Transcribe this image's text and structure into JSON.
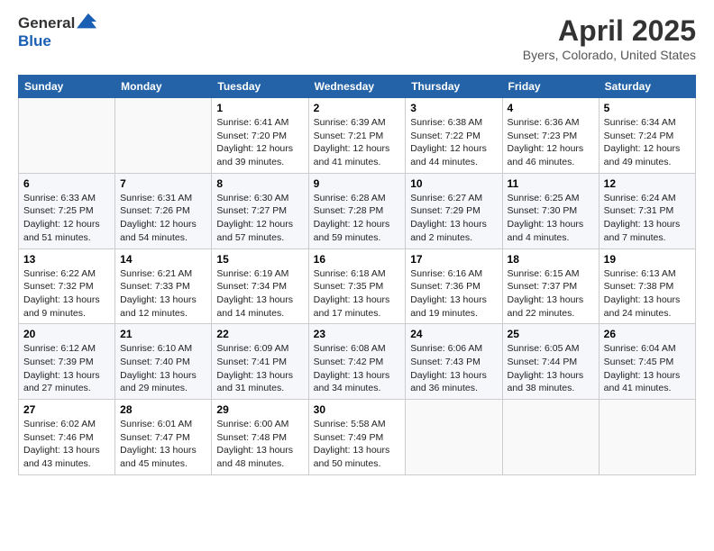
{
  "header": {
    "logo_line1": "General",
    "logo_line2": "Blue",
    "title": "April 2025",
    "subtitle": "Byers, Colorado, United States"
  },
  "weekdays": [
    "Sunday",
    "Monday",
    "Tuesday",
    "Wednesday",
    "Thursday",
    "Friday",
    "Saturday"
  ],
  "weeks": [
    [
      {
        "day": "",
        "info": ""
      },
      {
        "day": "",
        "info": ""
      },
      {
        "day": "1",
        "info": "Sunrise: 6:41 AM\nSunset: 7:20 PM\nDaylight: 12 hours and 39 minutes."
      },
      {
        "day": "2",
        "info": "Sunrise: 6:39 AM\nSunset: 7:21 PM\nDaylight: 12 hours and 41 minutes."
      },
      {
        "day": "3",
        "info": "Sunrise: 6:38 AM\nSunset: 7:22 PM\nDaylight: 12 hours and 44 minutes."
      },
      {
        "day": "4",
        "info": "Sunrise: 6:36 AM\nSunset: 7:23 PM\nDaylight: 12 hours and 46 minutes."
      },
      {
        "day": "5",
        "info": "Sunrise: 6:34 AM\nSunset: 7:24 PM\nDaylight: 12 hours and 49 minutes."
      }
    ],
    [
      {
        "day": "6",
        "info": "Sunrise: 6:33 AM\nSunset: 7:25 PM\nDaylight: 12 hours and 51 minutes."
      },
      {
        "day": "7",
        "info": "Sunrise: 6:31 AM\nSunset: 7:26 PM\nDaylight: 12 hours and 54 minutes."
      },
      {
        "day": "8",
        "info": "Sunrise: 6:30 AM\nSunset: 7:27 PM\nDaylight: 12 hours and 57 minutes."
      },
      {
        "day": "9",
        "info": "Sunrise: 6:28 AM\nSunset: 7:28 PM\nDaylight: 12 hours and 59 minutes."
      },
      {
        "day": "10",
        "info": "Sunrise: 6:27 AM\nSunset: 7:29 PM\nDaylight: 13 hours and 2 minutes."
      },
      {
        "day": "11",
        "info": "Sunrise: 6:25 AM\nSunset: 7:30 PM\nDaylight: 13 hours and 4 minutes."
      },
      {
        "day": "12",
        "info": "Sunrise: 6:24 AM\nSunset: 7:31 PM\nDaylight: 13 hours and 7 minutes."
      }
    ],
    [
      {
        "day": "13",
        "info": "Sunrise: 6:22 AM\nSunset: 7:32 PM\nDaylight: 13 hours and 9 minutes."
      },
      {
        "day": "14",
        "info": "Sunrise: 6:21 AM\nSunset: 7:33 PM\nDaylight: 13 hours and 12 minutes."
      },
      {
        "day": "15",
        "info": "Sunrise: 6:19 AM\nSunset: 7:34 PM\nDaylight: 13 hours and 14 minutes."
      },
      {
        "day": "16",
        "info": "Sunrise: 6:18 AM\nSunset: 7:35 PM\nDaylight: 13 hours and 17 minutes."
      },
      {
        "day": "17",
        "info": "Sunrise: 6:16 AM\nSunset: 7:36 PM\nDaylight: 13 hours and 19 minutes."
      },
      {
        "day": "18",
        "info": "Sunrise: 6:15 AM\nSunset: 7:37 PM\nDaylight: 13 hours and 22 minutes."
      },
      {
        "day": "19",
        "info": "Sunrise: 6:13 AM\nSunset: 7:38 PM\nDaylight: 13 hours and 24 minutes."
      }
    ],
    [
      {
        "day": "20",
        "info": "Sunrise: 6:12 AM\nSunset: 7:39 PM\nDaylight: 13 hours and 27 minutes."
      },
      {
        "day": "21",
        "info": "Sunrise: 6:10 AM\nSunset: 7:40 PM\nDaylight: 13 hours and 29 minutes."
      },
      {
        "day": "22",
        "info": "Sunrise: 6:09 AM\nSunset: 7:41 PM\nDaylight: 13 hours and 31 minutes."
      },
      {
        "day": "23",
        "info": "Sunrise: 6:08 AM\nSunset: 7:42 PM\nDaylight: 13 hours and 34 minutes."
      },
      {
        "day": "24",
        "info": "Sunrise: 6:06 AM\nSunset: 7:43 PM\nDaylight: 13 hours and 36 minutes."
      },
      {
        "day": "25",
        "info": "Sunrise: 6:05 AM\nSunset: 7:44 PM\nDaylight: 13 hours and 38 minutes."
      },
      {
        "day": "26",
        "info": "Sunrise: 6:04 AM\nSunset: 7:45 PM\nDaylight: 13 hours and 41 minutes."
      }
    ],
    [
      {
        "day": "27",
        "info": "Sunrise: 6:02 AM\nSunset: 7:46 PM\nDaylight: 13 hours and 43 minutes."
      },
      {
        "day": "28",
        "info": "Sunrise: 6:01 AM\nSunset: 7:47 PM\nDaylight: 13 hours and 45 minutes."
      },
      {
        "day": "29",
        "info": "Sunrise: 6:00 AM\nSunset: 7:48 PM\nDaylight: 13 hours and 48 minutes."
      },
      {
        "day": "30",
        "info": "Sunrise: 5:58 AM\nSunset: 7:49 PM\nDaylight: 13 hours and 50 minutes."
      },
      {
        "day": "",
        "info": ""
      },
      {
        "day": "",
        "info": ""
      },
      {
        "day": "",
        "info": ""
      }
    ]
  ]
}
